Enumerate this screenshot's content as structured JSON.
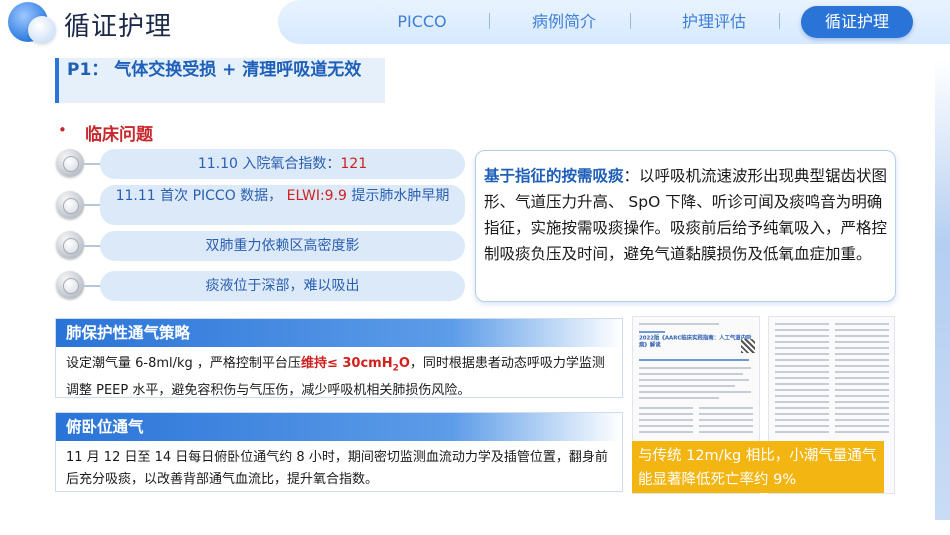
{
  "header": {
    "title": "循证护理",
    "nav": [
      {
        "label": "PICCO"
      },
      {
        "label": "病例简介"
      },
      {
        "label": "护理评估"
      },
      {
        "label": "循证护理"
      }
    ]
  },
  "problem": {
    "title": "P1： 气体交换受损 + 清理呼吸道无效"
  },
  "clinical": {
    "heading": "临床问题",
    "items": [
      {
        "text": "11.10 入院氧合指数：",
        "highlight": "121"
      },
      {
        "text_before": "11.11 首次 PICCO 数据，",
        "highlight": "ELWI:9.9",
        "text_after": "提示肺水肿早期"
      },
      {
        "text": "双肺重力依赖区高密度影"
      },
      {
        "text": "痰液位于深部，难以吸出"
      }
    ]
  },
  "info_box": {
    "highlight": "基于指征的按需吸痰",
    "text": "：以呼吸机流速波形出现典型锯齿状图形、气道压力升高、 SpO 下降、听诊可闻及痰鸣音为明确指征，实施按需吸痰操作。吸痰前后给予纯氧吸入，严格控制吸痰负压及时间，避免气道黏膜损伤及低氧血症加重。"
  },
  "strategies": [
    {
      "title": "肺保护性通气策略",
      "body_before": "设定潮气量 6-8ml/kg ，严格控制平台压",
      "body_highlight": "维持≤ 30cmH",
      "body_highlight_sub": "2",
      "body_highlight_end": "O",
      "body_after": "，同时根据患者动态呼吸力学监测调整 PEEP 水平，避免容积伤与气压伤，减少呼吸机相关肺损伤风险。"
    },
    {
      "title": "俯卧位通气",
      "body": "11 月 12 日至 14 日每日俯卧位通气约 8 小时，期间密切监测血流动力学及插管位置，翻身前后充分吸痰，以改善背部通气血流比，提升氧合指数。"
    }
  ],
  "paper_thumbnail": {
    "heading": "2022版《AARC临床实践指南：人工气道内吸痰》解读"
  },
  "evidence_note": {
    "text": "与传统 12m/kg 相比，小潮气量通气能显著降低死亡率约 9%"
  },
  "colors": {
    "primary": "#2a74d8",
    "accent_red": "#c8272d",
    "highlight_yellow": "#f3b511"
  }
}
